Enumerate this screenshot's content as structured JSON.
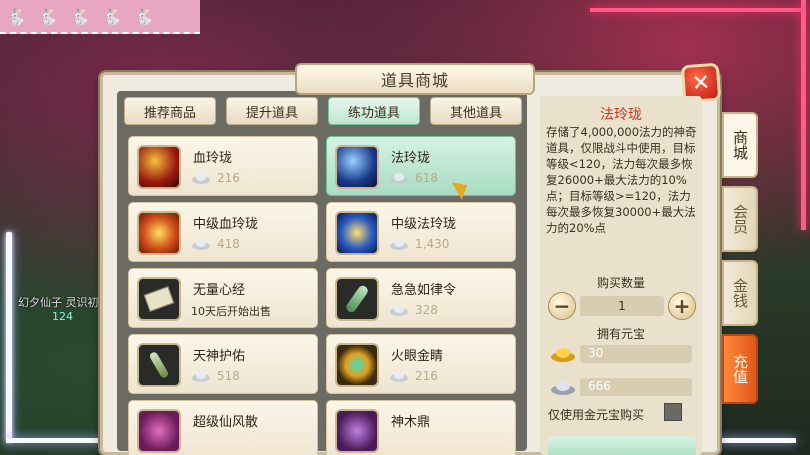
{
  "window": {
    "title": "道具商城",
    "close_label": "✕"
  },
  "tabs": [
    {
      "label": "推荐商品",
      "active": false
    },
    {
      "label": "提升道具",
      "active": false
    },
    {
      "label": "练功道具",
      "active": true
    },
    {
      "label": "其他道具",
      "active": false
    }
  ],
  "items": [
    {
      "name": "血玲珑",
      "price": "216",
      "icon": "blood-orb-icon",
      "selected": false
    },
    {
      "name": "法玲珑",
      "price": "618",
      "icon": "mana-orb-icon",
      "selected": true
    },
    {
      "name": "中级血玲珑",
      "price": "418",
      "icon": "mid-blood-orb-icon",
      "selected": false
    },
    {
      "name": "中级法玲珑",
      "price": "1,430",
      "icon": "mid-mana-orb-icon",
      "selected": false
    },
    {
      "name": "无量心经",
      "note": "10天后开始出售",
      "icon": "scroll-icon",
      "selected": false
    },
    {
      "name": "急急如律令",
      "price": "328",
      "icon": "talisman-icon",
      "selected": false
    },
    {
      "name": "天神护佑",
      "price": "518",
      "icon": "blessing-icon",
      "selected": false
    },
    {
      "name": "火眼金睛",
      "price": "216",
      "icon": "eye-icon",
      "selected": false
    },
    {
      "name": "超级仙风散",
      "price": "",
      "icon": "powder-icon",
      "selected": false
    },
    {
      "name": "神木鼎",
      "price": "",
      "icon": "cauldron-icon",
      "selected": false
    }
  ],
  "detail": {
    "title": "法玲珑",
    "description": "存储了4,000,000法力的神奇道具，仅限战斗中使用，目标等级<120，法力每次最多恢复26000+最大法力的10%点；目标等级>=120，法力每次最多恢复30000+最大法力的20%点",
    "qty_label": "购买数量",
    "qty_minus": "−",
    "qty_value": "1",
    "qty_plus": "+",
    "owned_label": "拥有元宝",
    "gold_amount": "30",
    "silver_amount": "666",
    "only_gold_label": "仅使用金元宝购买"
  },
  "side_tabs": [
    {
      "label": "商城",
      "active": true
    },
    {
      "label": "会员",
      "active": false
    },
    {
      "label": "金钱",
      "active": false
    },
    {
      "label": "充值",
      "active": false
    }
  ],
  "scene": {
    "character_name": "幻夕仙子 灵识初",
    "character_level": "124"
  },
  "colors": {
    "accent_green": "#9cd8b8",
    "title_red": "#c43a1a",
    "recharge_orange": "#e0561a",
    "close_red": "#c01a10"
  }
}
